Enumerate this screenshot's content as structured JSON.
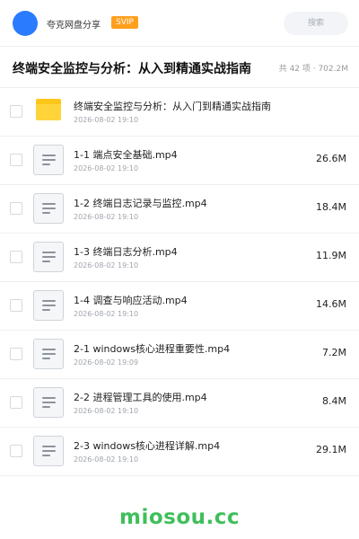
{
  "header": {
    "brand": "夸克网盘分享",
    "badge": "SVIP",
    "search_placeholder": "搜索"
  },
  "page": {
    "title": "终端安全监控与分析：从入到精通实战指南",
    "summary": "共 42 项 · 702.2M"
  },
  "files": [
    {
      "type": "folder",
      "name": "终端安全监控与分析：从入门到精通实战指南",
      "date": "2026-08-02 19:10",
      "size": ""
    },
    {
      "type": "file",
      "name": "1-1 端点安全基础.mp4",
      "date": "2026-08-02 19:10",
      "size": "26.6M"
    },
    {
      "type": "file",
      "name": "1-2 终端日志记录与监控.mp4",
      "date": "2026-08-02 19:10",
      "size": "18.4M"
    },
    {
      "type": "file",
      "name": "1-3 终端日志分析.mp4",
      "date": "2026-08-02 19:10",
      "size": "11.9M"
    },
    {
      "type": "file",
      "name": "1-4 调查与响应活动.mp4",
      "date": "2026-08-02 19:10",
      "size": "14.6M"
    },
    {
      "type": "file",
      "name": "2-1 windows核心进程重要性.mp4",
      "date": "2026-08-02 19:09",
      "size": "7.2M"
    },
    {
      "type": "file",
      "name": "2-2 进程管理工具的使用.mp4",
      "date": "2026-08-02 19:10",
      "size": "8.4M"
    },
    {
      "type": "file",
      "name": "2-3 windows核心进程详解.mp4",
      "date": "2026-08-02 19:10",
      "size": "29.1M"
    }
  ],
  "watermark": "miosou.cc",
  "colors": {
    "avatar": "#2b7bff",
    "badge": "#ff9f1c",
    "folder": "#ffd43b",
    "watermark": "#3fbf5b"
  },
  "icons": {
    "folder": "folder-icon",
    "file": "file-icon"
  }
}
